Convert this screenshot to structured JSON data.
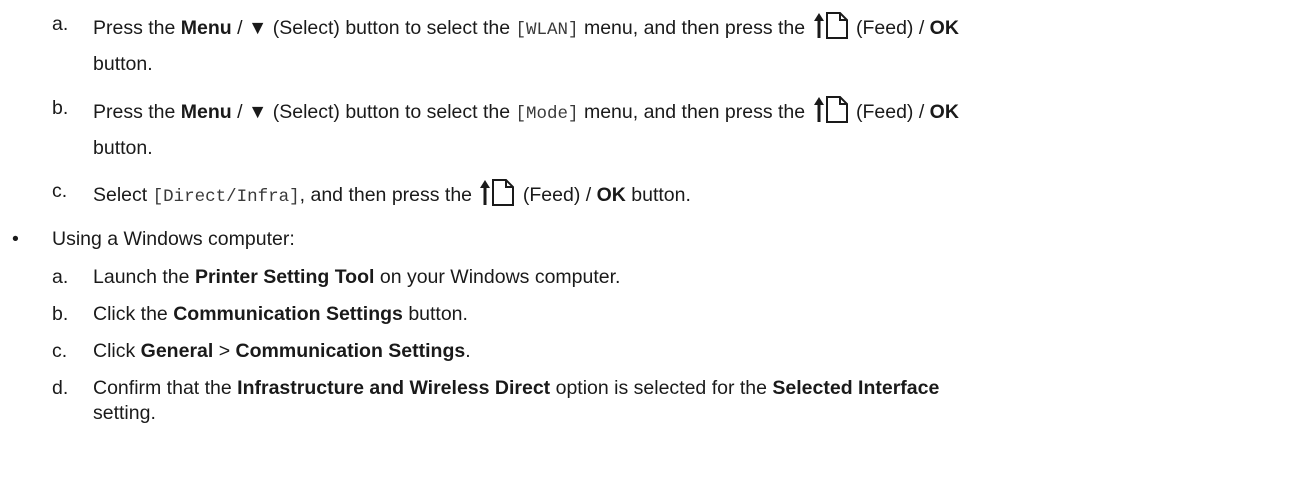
{
  "common": {
    "press_the": "Press the",
    "menu": "Menu",
    "select_arrow": "▼",
    "select_suffix": "(Select) button to select the",
    "menu_then_press": "menu, and then press the",
    "feed": "(Feed) /",
    "ok": "OK",
    "button": "button.",
    "feed_icon": "feed-icon"
  },
  "panel_steps": [
    {
      "marker": "a.",
      "item": "[WLAN]"
    },
    {
      "marker": "b.",
      "item": "[Mode]"
    },
    {
      "marker": "c.",
      "select": "Select",
      "value": "[Direct/Infra]",
      "then_press": ", and then press the"
    }
  ],
  "windows": {
    "bullet": "•",
    "heading": "Using a Windows computer:",
    "steps": [
      {
        "marker": "a.",
        "pre": "Launch the",
        "bold": "Printer Setting Tool",
        "post": "on your Windows computer."
      },
      {
        "marker": "b.",
        "pre": "Click the",
        "bold": "Communication Settings",
        "post": "button."
      },
      {
        "marker": "c.",
        "pre": "Click",
        "bold1": "General",
        "sep": ">",
        "bold2": "Communication Settings",
        "post": "."
      },
      {
        "marker": "d.",
        "pre": "Confirm that the",
        "bold1": "Infrastructure and Wireless Direct",
        "mid": "option is selected for the",
        "bold2": "Selected Interface",
        "post": "setting."
      }
    ]
  }
}
